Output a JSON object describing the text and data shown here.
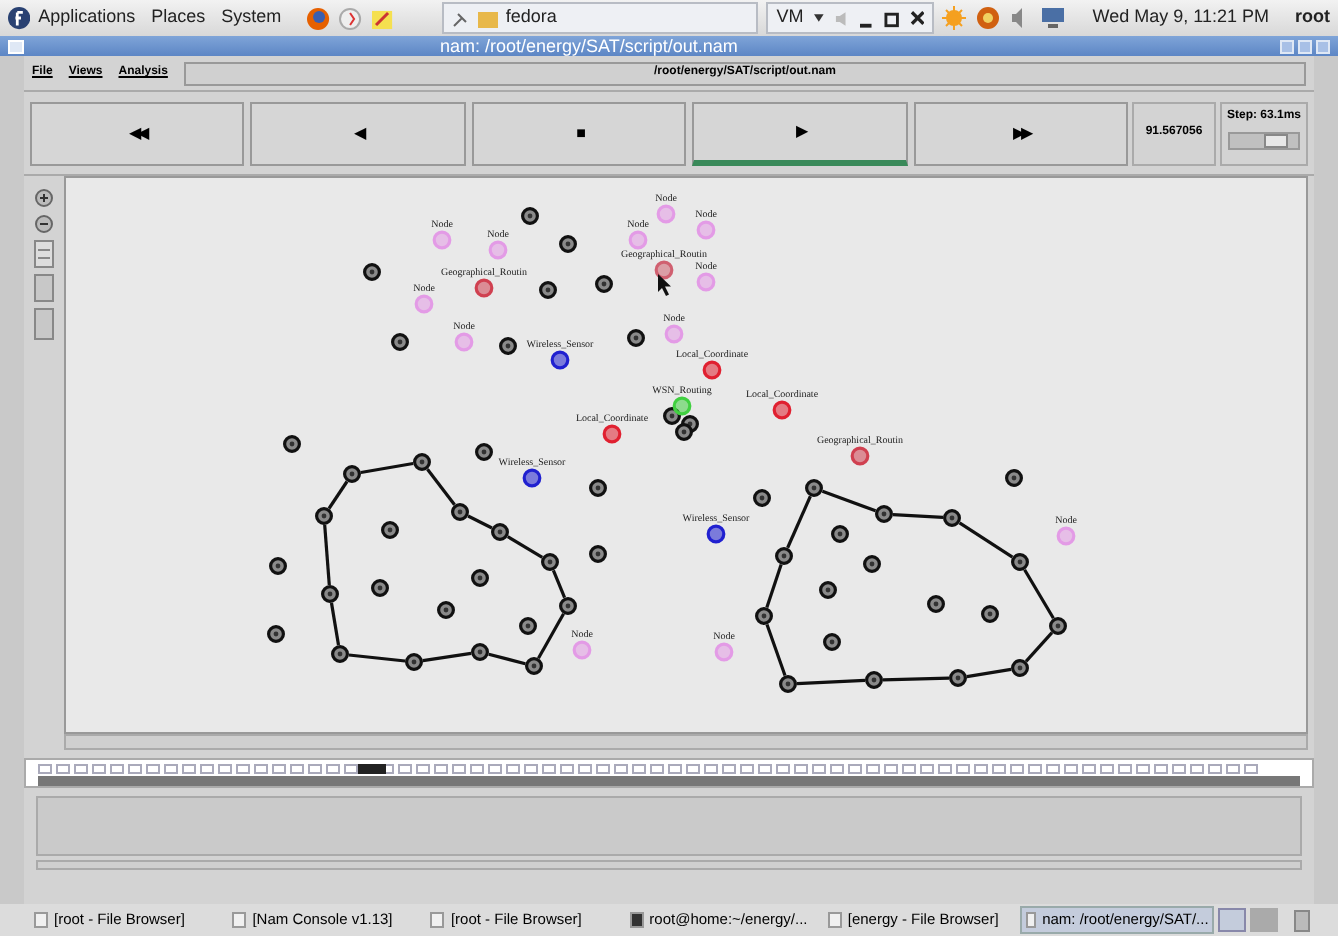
{
  "top_panel": {
    "menus": [
      "Applications",
      "Places",
      "System"
    ],
    "window_button": "fedora",
    "vm_menu": "VM",
    "clock": "Wed May  9, 11:21 PM",
    "user": "root"
  },
  "window": {
    "title": "nam: /root/energy/SAT/script/out.nam"
  },
  "menu_bar": {
    "items": [
      "File",
      "Views",
      "Analysis"
    ],
    "file_path": "/root/energy/SAT/script/out.nam"
  },
  "playback": {
    "buttons": [
      {
        "symbol": "◀◀",
        "selected": false
      },
      {
        "symbol": "◀",
        "selected": false
      },
      {
        "symbol": "■",
        "selected": false
      },
      {
        "symbol": "▶",
        "selected": true
      },
      {
        "symbol": "▶▶",
        "selected": false
      }
    ],
    "time": "91.567056",
    "step": "Step: 63.1ms",
    "step_slider": {
      "level": 0.75
    }
  },
  "nodes": [
    {
      "label": "Node",
      "color": "#e39be6"
    },
    {
      "label": "Node",
      "color": "#e39be6"
    },
    {
      "label": "Node",
      "color": "#e39be6"
    },
    {
      "label": "Node",
      "color": "#e39be6"
    },
    {
      "label": "Node",
      "color": "#e39be6"
    },
    {
      "label": "Geographical_Routin",
      "color": "#d06070"
    },
    {
      "label": "Node",
      "color": "#e39be6"
    },
    {
      "label": "Geographical_Routin",
      "color": "#d04050"
    },
    {
      "label": "Node",
      "color": "#e39be6"
    },
    {
      "label": "Node",
      "color": "#e39be6"
    },
    {
      "label": "Node",
      "color": "#e39be6"
    },
    {
      "label": "Wireless_Sensor",
      "color": "#2020d0"
    },
    {
      "label": "Local_Coordinate",
      "color": "#e02030"
    },
    {
      "label": "WSN_Routing",
      "color": "#40d040"
    },
    {
      "label": "Local_Coordinate",
      "color": "#e02030"
    },
    {
      "label": "Local_Coordinate",
      "color": "#e02030"
    },
    {
      "label": "Geographical_Routin",
      "color": "#d04050"
    },
    {
      "label": "Wireless_Sensor",
      "color": "#2020d0"
    },
    {
      "label": "Wireless_Sensor",
      "color": "#2020d0"
    },
    {
      "label": "Node",
      "color": "#e39be6"
    },
    {
      "label": "Node",
      "color": "#e39be6"
    },
    {
      "label": "Node",
      "color": "#e39be6"
    }
  ],
  "taskbar": [
    {
      "label": "[root - File Browser]",
      "selected": false
    },
    {
      "label": "[Nam Console v1.13]",
      "selected": false
    },
    {
      "label": "[root - File Browser]",
      "selected": false
    },
    {
      "label": "root@home:~/energy/...",
      "selected": false
    },
    {
      "label": "[energy - File Browser]",
      "selected": false
    },
    {
      "label": "nam: /root/energy/SAT/...",
      "selected": true
    }
  ]
}
